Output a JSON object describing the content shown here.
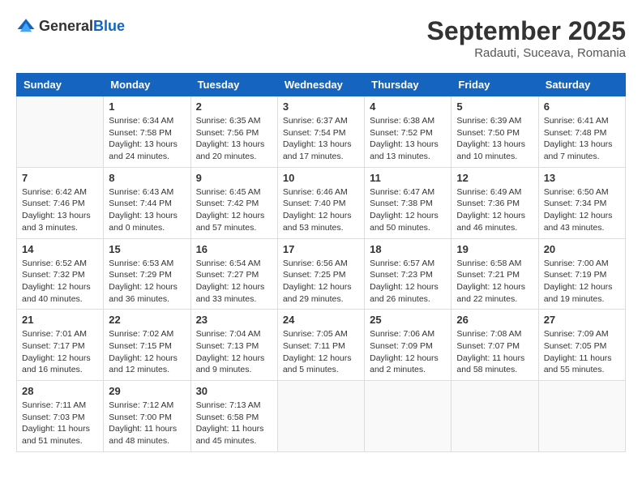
{
  "header": {
    "logo_general": "General",
    "logo_blue": "Blue",
    "month": "September 2025",
    "location": "Radauti, Suceava, Romania"
  },
  "weekdays": [
    "Sunday",
    "Monday",
    "Tuesday",
    "Wednesday",
    "Thursday",
    "Friday",
    "Saturday"
  ],
  "weeks": [
    [
      {
        "day": "",
        "info": ""
      },
      {
        "day": "1",
        "info": "Sunrise: 6:34 AM\nSunset: 7:58 PM\nDaylight: 13 hours\nand 24 minutes."
      },
      {
        "day": "2",
        "info": "Sunrise: 6:35 AM\nSunset: 7:56 PM\nDaylight: 13 hours\nand 20 minutes."
      },
      {
        "day": "3",
        "info": "Sunrise: 6:37 AM\nSunset: 7:54 PM\nDaylight: 13 hours\nand 17 minutes."
      },
      {
        "day": "4",
        "info": "Sunrise: 6:38 AM\nSunset: 7:52 PM\nDaylight: 13 hours\nand 13 minutes."
      },
      {
        "day": "5",
        "info": "Sunrise: 6:39 AM\nSunset: 7:50 PM\nDaylight: 13 hours\nand 10 minutes."
      },
      {
        "day": "6",
        "info": "Sunrise: 6:41 AM\nSunset: 7:48 PM\nDaylight: 13 hours\nand 7 minutes."
      }
    ],
    [
      {
        "day": "7",
        "info": "Sunrise: 6:42 AM\nSunset: 7:46 PM\nDaylight: 13 hours\nand 3 minutes."
      },
      {
        "day": "8",
        "info": "Sunrise: 6:43 AM\nSunset: 7:44 PM\nDaylight: 13 hours\nand 0 minutes."
      },
      {
        "day": "9",
        "info": "Sunrise: 6:45 AM\nSunset: 7:42 PM\nDaylight: 12 hours\nand 57 minutes."
      },
      {
        "day": "10",
        "info": "Sunrise: 6:46 AM\nSunset: 7:40 PM\nDaylight: 12 hours\nand 53 minutes."
      },
      {
        "day": "11",
        "info": "Sunrise: 6:47 AM\nSunset: 7:38 PM\nDaylight: 12 hours\nand 50 minutes."
      },
      {
        "day": "12",
        "info": "Sunrise: 6:49 AM\nSunset: 7:36 PM\nDaylight: 12 hours\nand 46 minutes."
      },
      {
        "day": "13",
        "info": "Sunrise: 6:50 AM\nSunset: 7:34 PM\nDaylight: 12 hours\nand 43 minutes."
      }
    ],
    [
      {
        "day": "14",
        "info": "Sunrise: 6:52 AM\nSunset: 7:32 PM\nDaylight: 12 hours\nand 40 minutes."
      },
      {
        "day": "15",
        "info": "Sunrise: 6:53 AM\nSunset: 7:29 PM\nDaylight: 12 hours\nand 36 minutes."
      },
      {
        "day": "16",
        "info": "Sunrise: 6:54 AM\nSunset: 7:27 PM\nDaylight: 12 hours\nand 33 minutes."
      },
      {
        "day": "17",
        "info": "Sunrise: 6:56 AM\nSunset: 7:25 PM\nDaylight: 12 hours\nand 29 minutes."
      },
      {
        "day": "18",
        "info": "Sunrise: 6:57 AM\nSunset: 7:23 PM\nDaylight: 12 hours\nand 26 minutes."
      },
      {
        "day": "19",
        "info": "Sunrise: 6:58 AM\nSunset: 7:21 PM\nDaylight: 12 hours\nand 22 minutes."
      },
      {
        "day": "20",
        "info": "Sunrise: 7:00 AM\nSunset: 7:19 PM\nDaylight: 12 hours\nand 19 minutes."
      }
    ],
    [
      {
        "day": "21",
        "info": "Sunrise: 7:01 AM\nSunset: 7:17 PM\nDaylight: 12 hours\nand 16 minutes."
      },
      {
        "day": "22",
        "info": "Sunrise: 7:02 AM\nSunset: 7:15 PM\nDaylight: 12 hours\nand 12 minutes."
      },
      {
        "day": "23",
        "info": "Sunrise: 7:04 AM\nSunset: 7:13 PM\nDaylight: 12 hours\nand 9 minutes."
      },
      {
        "day": "24",
        "info": "Sunrise: 7:05 AM\nSunset: 7:11 PM\nDaylight: 12 hours\nand 5 minutes."
      },
      {
        "day": "25",
        "info": "Sunrise: 7:06 AM\nSunset: 7:09 PM\nDaylight: 12 hours\nand 2 minutes."
      },
      {
        "day": "26",
        "info": "Sunrise: 7:08 AM\nSunset: 7:07 PM\nDaylight: 11 hours\nand 58 minutes."
      },
      {
        "day": "27",
        "info": "Sunrise: 7:09 AM\nSunset: 7:05 PM\nDaylight: 11 hours\nand 55 minutes."
      }
    ],
    [
      {
        "day": "28",
        "info": "Sunrise: 7:11 AM\nSunset: 7:03 PM\nDaylight: 11 hours\nand 51 minutes."
      },
      {
        "day": "29",
        "info": "Sunrise: 7:12 AM\nSunset: 7:00 PM\nDaylight: 11 hours\nand 48 minutes."
      },
      {
        "day": "30",
        "info": "Sunrise: 7:13 AM\nSunset: 6:58 PM\nDaylight: 11 hours\nand 45 minutes."
      },
      {
        "day": "",
        "info": ""
      },
      {
        "day": "",
        "info": ""
      },
      {
        "day": "",
        "info": ""
      },
      {
        "day": "",
        "info": ""
      }
    ]
  ]
}
